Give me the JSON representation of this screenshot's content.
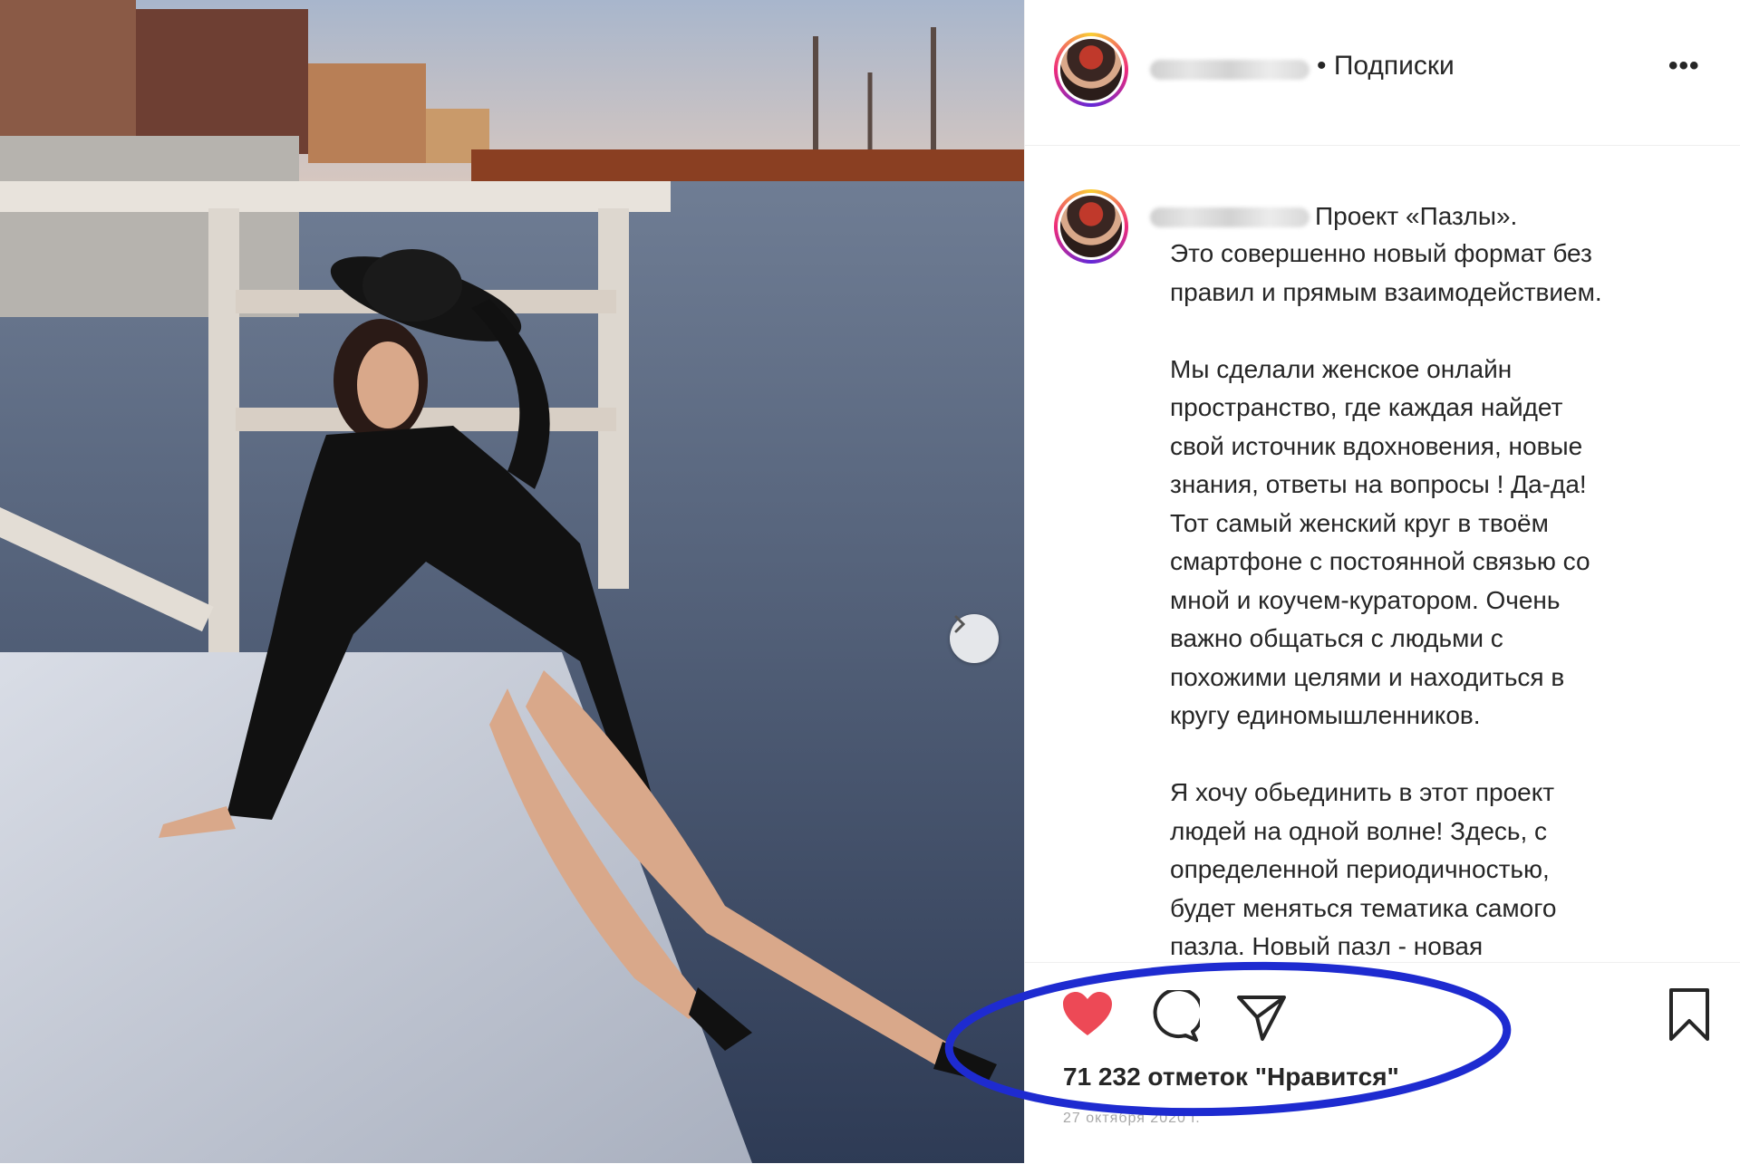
{
  "post": {
    "follow_label": "• Подписки",
    "more_label": "•••",
    "caption_head": "Проект «Пазлы».",
    "caption_body": "Это совершенно новый формат без\nправил и прямым взаимодействием.\n\nМы сделали женское онлайн\nпространство, где каждая найдет\nсвой источник вдохновения, новые\nзнания, ответы на вопросы ! Да-да!\nТот самый женский круг в твоём\nсмартфоне с постоянной связью со\nмной и коучем-куратором. Очень\nважно общаться с людьми с\nпохожими целями и находиться в\nкругу единомышленников.\n\nЯ хочу обьединить в этот проект\nлюдей на одной волне! Здесь, с\nопределенной периодичностью,\nбудет меняться тематика самого\nпазла. Новый пазл - новая",
    "likes": "71 232 отметок \"Нравится\"",
    "date": "27 октября 2020 г."
  },
  "icons": {
    "like": "heart-icon",
    "comment": "comment-icon",
    "share": "share-icon",
    "save": "bookmark-icon",
    "next": "chevron-right-icon"
  },
  "colors": {
    "like_red": "#ed4956",
    "annotation_blue": "#1e2bd0",
    "text": "#262626"
  }
}
